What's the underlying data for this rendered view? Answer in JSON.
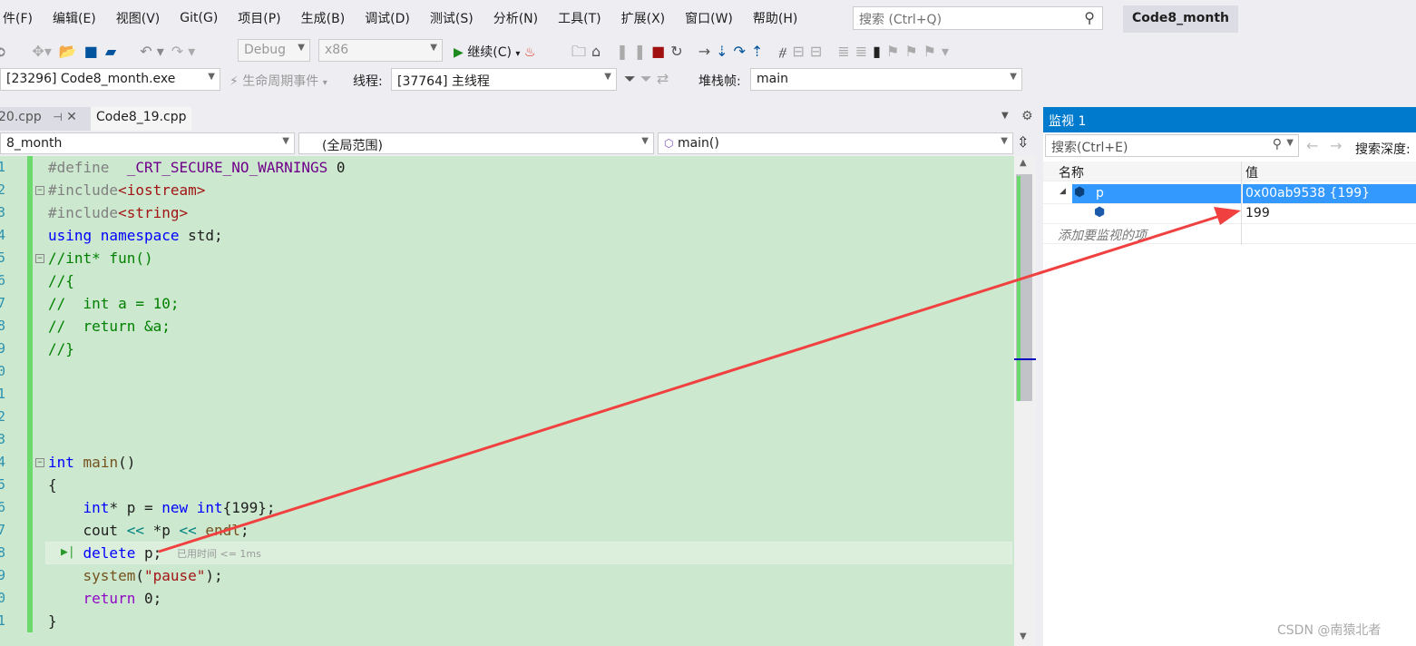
{
  "menu": [
    "件(F)",
    "编辑(E)",
    "视图(V)",
    "Git(G)",
    "项目(P)",
    "生成(B)",
    "调试(D)",
    "测试(S)",
    "分析(N)",
    "工具(T)",
    "扩展(X)",
    "窗口(W)",
    "帮助(H)"
  ],
  "search": {
    "placeholder": "搜索 (Ctrl+Q)"
  },
  "solution_title": "Code8_month",
  "toolbar": {
    "config": "Debug",
    "platform": "x86",
    "continue": "继续(C)"
  },
  "debugbar": {
    "process": "[23296] Code8_month.exe",
    "lifecycle": "生命周期事件",
    "thread_label": "线程:",
    "thread": "[37764] 主线程",
    "stack_label": "堆栈帧:",
    "stack": "main"
  },
  "tabs": [
    {
      "label": "20.cpp"
    },
    {
      "label": "Code8_19.cpp"
    }
  ],
  "nav": {
    "project": "8_month",
    "scope": "(全局范围)",
    "member": "main()"
  },
  "editor": {
    "line_numbers": [
      "1",
      "2",
      "3",
      "4",
      "5",
      "6",
      "7",
      "8",
      "9",
      "0",
      "1",
      "2",
      "3",
      "4",
      "5",
      "6",
      "7",
      "8",
      "9",
      "0",
      "1"
    ],
    "perf_tip": "已用时间 <= 1ms"
  },
  "watch": {
    "title": "监视 1",
    "search_placeholder": "搜索(Ctrl+E)",
    "depth_label": "搜索深度:",
    "col_name": "名称",
    "col_value": "值",
    "rows": [
      {
        "name": "p",
        "value": "0x00ab9538 {199}"
      },
      {
        "name": "",
        "value": "199"
      }
    ],
    "add_hint": "添加要监视的项"
  },
  "watermark": "CSDN @南猿北者",
  "colors": {
    "accent": "#007acc",
    "annotation_arrow": "#f04040",
    "editor_bg": "#cce8cf"
  }
}
